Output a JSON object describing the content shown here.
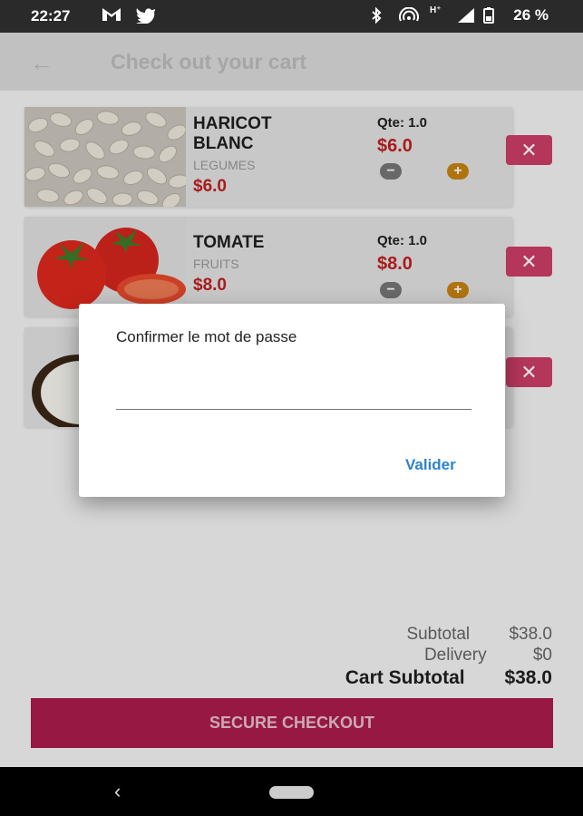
{
  "status_bar": {
    "time": "22:27",
    "battery": "26 %",
    "icons": [
      "gmail-icon",
      "twitter-icon",
      "bluetooth-icon",
      "hotspot-icon",
      "h-plus-icon",
      "signal-icon",
      "battery-icon"
    ]
  },
  "app_bar": {
    "title": "Check out your cart",
    "back_icon": "arrow-back-icon"
  },
  "cart": {
    "items": [
      {
        "name": "HARICOT BLANC",
        "category": "LEGUMES",
        "price": "$6.0",
        "qty": "Qte: 1.0",
        "line_total": "$6.0"
      },
      {
        "name": "TOMATE",
        "category": "FRUITS",
        "price": "$8.0",
        "qty": "Qte: 1.0",
        "line_total": "$8.0"
      },
      {
        "name": "",
        "category": "",
        "price": "",
        "qty": "",
        "line_total": ""
      }
    ],
    "minus_symbol": "−",
    "plus_symbol": "+",
    "remove_symbol": "✕"
  },
  "dialog": {
    "label": "Confirmer le mot de passe",
    "input_value": "",
    "button": "Valider"
  },
  "summary": {
    "subtotal_label": "Subtotal",
    "subtotal_value": "$38.0",
    "delivery_label": "Delivery",
    "delivery_value": "$0",
    "cart_subtotal_label": "Cart Subtotal",
    "cart_subtotal_value": "$38.0"
  },
  "checkout_button": "SECURE CHECKOUT",
  "nav": {
    "back_symbol": "‹"
  },
  "colors": {
    "accent": "#cd3e67",
    "price": "#c01f1f",
    "dialog_button": "#2f83c9",
    "checkout": "#ab1c4d"
  }
}
